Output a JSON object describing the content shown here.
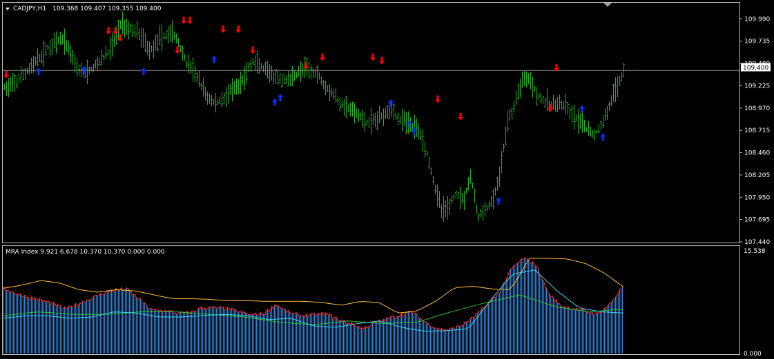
{
  "colors": {
    "background": "#000000",
    "frame": "#c0c0c0",
    "bars": "#22b422",
    "sell_arrow": "#ff0000",
    "buy_arrow": "#0033ff",
    "current_price_line": "#8a8a8a",
    "index_bars": "#2e7fd0",
    "index_red": "#ff2020",
    "index_orange": "#ffc040",
    "index_cyan": "#40d0f0",
    "index_green": "#30c030"
  },
  "main": {
    "symbol": "CADJPY,H1",
    "ohlc": "109.368 109.407 109.355 109.400",
    "price_label": "109.400"
  },
  "indicator": {
    "header": "MRA Index 9.921 6.678 10.370 10.370 0.000 0.000",
    "top_label": "15.538",
    "bottom_label": "0.000"
  },
  "chart_data": [
    {
      "type": "ohlc",
      "symbol": "CADJPY",
      "timeframe": "H1",
      "yaxis_ticks": [
        "109.990",
        "109.735",
        "109.480",
        "109.225",
        "108.970",
        "108.715",
        "108.460",
        "108.205",
        "107.950",
        "107.695",
        "107.440"
      ],
      "ylim": [
        107.44,
        110.04
      ],
      "current_price": 109.4,
      "close_trace": [
        109.2,
        109.22,
        109.3,
        109.38,
        109.48,
        109.55,
        109.66,
        109.72,
        109.76,
        109.62,
        109.44,
        109.36,
        109.42,
        109.5,
        109.58,
        109.72,
        109.95,
        109.88,
        109.86,
        109.76,
        109.62,
        109.74,
        109.8,
        109.84,
        109.7,
        109.48,
        109.4,
        109.22,
        109.08,
        109.02,
        109.08,
        109.16,
        109.2,
        109.33,
        109.5,
        109.46,
        109.38,
        109.32,
        109.28,
        109.3,
        109.35,
        109.42,
        109.4,
        109.36,
        109.22,
        109.15,
        109.02,
        108.98,
        108.92,
        108.86,
        108.8,
        108.84,
        108.9,
        108.98,
        108.85,
        108.82,
        108.76,
        108.72,
        108.45,
        108.1,
        107.8,
        107.84,
        108.0,
        107.92,
        108.2,
        107.72,
        107.8,
        107.9,
        108.2,
        108.8,
        109.0,
        109.3,
        109.32,
        109.15,
        109.05,
        109.0,
        109.02,
        108.98,
        108.88,
        108.8,
        108.72,
        108.66,
        108.78,
        109.0,
        109.2,
        109.4
      ],
      "series": [
        {
          "name": "sell",
          "values": [
            109.34,
            109.84,
            109.84,
            109.76,
            109.96,
            109.96,
            109.62,
            109.86,
            109.86,
            109.62,
            109.44,
            109.54,
            109.54,
            109.5,
            109.06,
            108.86,
            109.42,
            108.96
          ]
        },
        {
          "name": "buy",
          "values": [
            109.4,
            109.42,
            109.4,
            109.54,
            109.05,
            109.1,
            109.04,
            108.8,
            108.72,
            107.92,
            108.97,
            108.65
          ]
        }
      ]
    },
    {
      "type": "bar",
      "title": "MRA Index",
      "values_header": [
        9.921,
        6.678,
        10.37,
        10.37,
        0.0,
        0.0
      ],
      "ylim": [
        0,
        15.538
      ],
      "bar_trace": [
        10.0,
        9.2,
        8.6,
        8.2,
        7.6,
        6.8,
        7.6,
        8.4,
        9.2,
        9.8,
        9.8,
        8.2,
        6.6,
        6.6,
        6.2,
        6.2,
        7.0,
        7.0,
        6.9,
        6.4,
        5.9,
        6.1,
        7.5,
        6.3,
        5.8,
        5.9,
        6.1,
        5.2,
        4.6,
        3.8,
        4.7,
        5.3,
        5.9,
        6.4,
        4.9,
        3.8,
        3.6,
        4.3,
        5.6,
        7.3,
        9.2,
        12.9,
        14.6,
        13.6,
        9.3,
        7.3,
        6.9,
        6.5,
        6.0,
        7.6,
        10.2
      ],
      "series": [
        {
          "name": "orange",
          "values": [
            10.0,
            10.5,
            11.2,
            10.8,
            9.8,
            9.4,
            9.8,
            9.6,
            9.0,
            8.4,
            8.4,
            8.3,
            8.1,
            8.1,
            8.0,
            8.0,
            8.0,
            7.8,
            7.4,
            8.0,
            7.8,
            6.2,
            6.5,
            8.0,
            10.1,
            10.3,
            9.9,
            9.8,
            14.6,
            14.6,
            14.5,
            13.8,
            12.3,
            10.2
          ]
        },
        {
          "name": "cyan",
          "values": [
            5.4,
            5.8,
            5.8,
            5.4,
            5.6,
            6.4,
            6.2,
            5.6,
            5.6,
            5.8,
            6.0,
            5.8,
            5.2,
            5.4,
            4.2,
            4.0,
            4.6,
            5.0,
            4.0,
            3.4,
            3.5,
            3.8,
            8.2,
            12.2,
            12.8,
            9.6,
            7.0,
            6.4,
            6.2
          ]
        },
        {
          "name": "green",
          "values": [
            5.8,
            6.4,
            6.0,
            6.0,
            6.4,
            6.4,
            6.0,
            5.6,
            4.8,
            4.4,
            5.0,
            4.6,
            4.8,
            6.4,
            7.8,
            9.0,
            7.2,
            6.4,
            6.8
          ]
        }
      ]
    }
  ]
}
